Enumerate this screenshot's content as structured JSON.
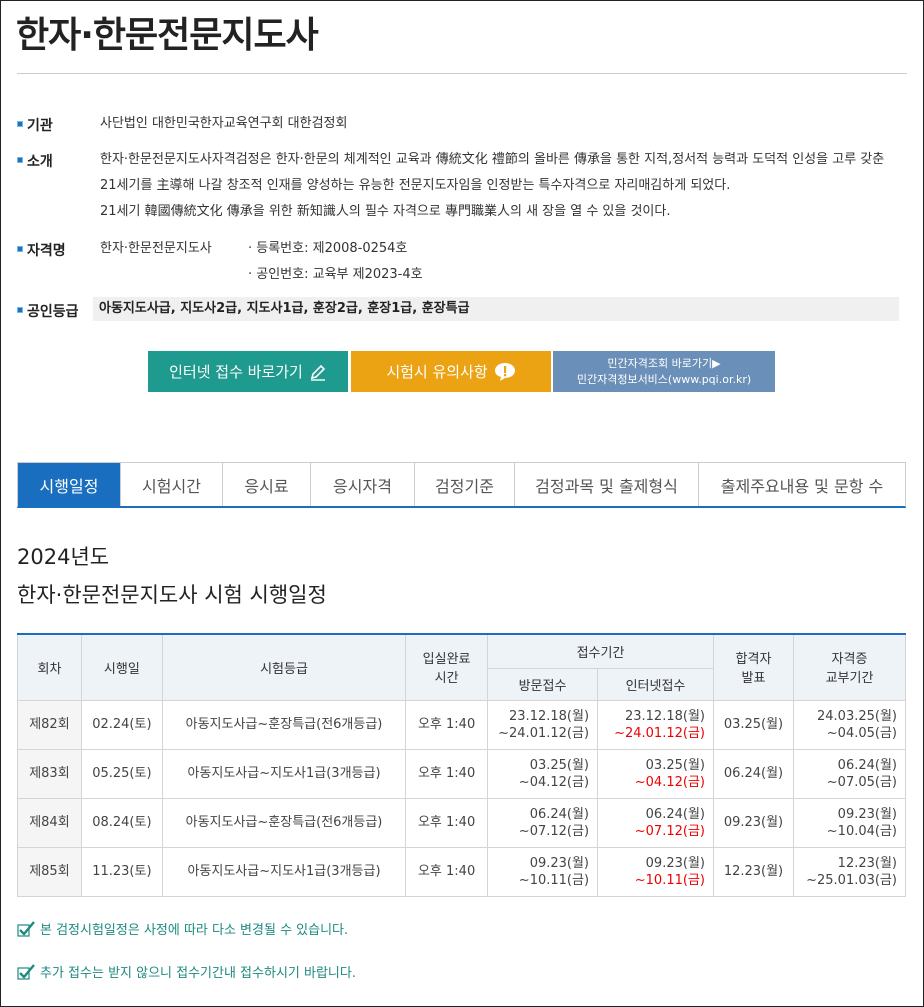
{
  "title": "한자·한문전문지도사",
  "info": {
    "agency_label": "기관",
    "agency_value": "사단법인 대한민국한자교육연구회 대한검정회",
    "intro_label": "소개",
    "intro_lines": [
      "한자·한문전문지도사자격검정은 한자·한문의 체계적인 교육과 傳統文化 禮節의 올바른 傳承을 통한 지적,정서적 능력과 도덕적 인성을 고루 갖춘",
      "21세기를 主導해 나갈 창조적 인재를 양성하는 유능한 전문지도자임을 인정받는 특수자격으로 자리매김하게 되었다.",
      "21세기 韓國傳統文化 傳承을 위한 新知識人의 필수 자격으로 專門職業人의 새 장을 열 수 있을 것이다."
    ],
    "qual_label": "자격명",
    "qual_value": "한자·한문전문지도사",
    "reg_no": "· 등록번호: 제2008-0254호",
    "cert_no": "· 공인번호: 교육부 제2023-4호",
    "grade_label": "공인등급",
    "grade_value": "아동지도사급, 지도사2급, 지도사1급, 훈장2급, 훈장1급, 훈장특급"
  },
  "buttons": {
    "apply": "인터넷 접수 바로가기",
    "notice": "시험시 유의사항",
    "pqi_line1": "민간자격조회 바로가기▶",
    "pqi_line2": "민간자격정보서비스(www.pqi.or.kr)"
  },
  "tabs": [
    "시행일정",
    "시험시간",
    "응시료",
    "응시자격",
    "검정기준",
    "검정과목 및 출제형식",
    "출제주요내용 및 문항 수"
  ],
  "schedule": {
    "year": "2024년도",
    "heading": "한자·한문전문지도사 시험 시행일정",
    "headers": {
      "round": "회차",
      "date": "시행일",
      "grade": "시험등급",
      "entry": [
        "입실완료",
        "시간"
      ],
      "period": "접수기간",
      "visit": "방문접수",
      "online": "인터넷접수",
      "result": [
        "합격자",
        "발표"
      ],
      "cert": [
        "자격증",
        "교부기간"
      ]
    },
    "rows": [
      {
        "round": "제82회",
        "date": "02.24(토)",
        "grade": "아동지도사급~훈장특급(전6개등급)",
        "time": "오후 1:40",
        "visit": [
          "23.12.18(월)",
          "~24.01.12(금)"
        ],
        "online": [
          "23.12.18(월)",
          "~24.01.12(금)"
        ],
        "result": "03.25(월)",
        "cert": [
          "24.03.25(월)",
          "~04.05(금)"
        ]
      },
      {
        "round": "제83회",
        "date": "05.25(토)",
        "grade": "아동지도사급~지도사1급(3개등급)",
        "time": "오후 1:40",
        "visit": [
          "03.25(월)",
          "~04.12(금)"
        ],
        "online": [
          "03.25(월)",
          "~04.12(금)"
        ],
        "result": "06.24(월)",
        "cert": [
          "06.24(월)",
          "~07.05(금)"
        ]
      },
      {
        "round": "제84회",
        "date": "08.24(토)",
        "grade": "아동지도사급~훈장특급(전6개등급)",
        "time": "오후 1:40",
        "visit": [
          "06.24(월)",
          "~07.12(금)"
        ],
        "online": [
          "06.24(월)",
          "~07.12(금)"
        ],
        "result": "09.23(월)",
        "cert": [
          "09.23(월)",
          "~10.04(금)"
        ]
      },
      {
        "round": "제85회",
        "date": "11.23(토)",
        "grade": "아동지도사급~지도사1급(3개등급)",
        "time": "오후 1:40",
        "visit": [
          "09.23(월)",
          "~10.11(금)"
        ],
        "online": [
          "09.23(월)",
          "~10.11(금)"
        ],
        "result": "12.23(월)",
        "cert": [
          "12.23(월)",
          "~25.01.03(금)"
        ]
      }
    ]
  },
  "notices": [
    "본 검정시험일정은 사정에 따라 다소 변경될 수 있습니다.",
    "추가 접수는 받지 않으니 접수기간내 접수하시기 바랍니다."
  ],
  "colors": {
    "accent": "#1a6ec0",
    "teal": "#1f9a8f",
    "orange": "#eba314",
    "slate": "#6a8fb8",
    "deadline": "#e00000"
  }
}
